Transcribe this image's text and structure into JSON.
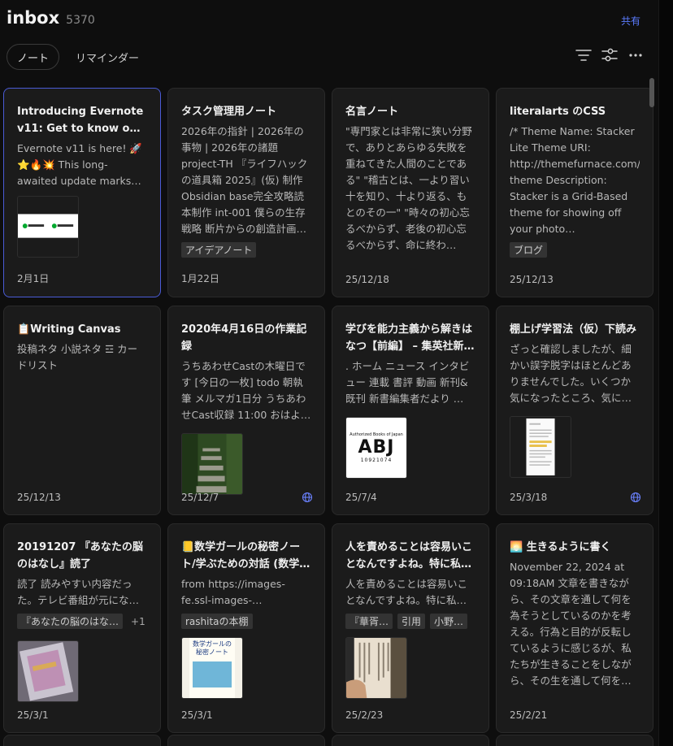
{
  "header": {
    "title": "inbox",
    "count": "5370",
    "share_label": "共有"
  },
  "tabs": [
    {
      "label": "ノート",
      "active": true
    },
    {
      "label": "リマインダー",
      "active": false
    }
  ],
  "toolbar": {
    "sort_icon": "sort-lines-icon",
    "filter_icon": "sliders-icon",
    "more_icon": "more-horizontal-icon"
  },
  "colors": {
    "accent": "#5b7cff",
    "selected_border": "#4a5bd6",
    "card_bg": "#1b1b1b",
    "page_bg": "#0e0e0e"
  },
  "notes": [
    {
      "title": "Introducing Evernote v11: Get to know our smarte…",
      "snippet": "Evernote v11 is here! 🚀⭐🔥💥 This long-awaited update marks t…",
      "tags": [],
      "date": "2月1日",
      "thumb": "evernote-logo"
    },
    {
      "title": "タスク管理用ノート",
      "snippet": "2026年の指針 | 2026年の事物 | 2026年の諸題 project-TH 『ライフハックの道具箱 2025』(仮) 制作 Obsidian base完全攻略読本制作 int-001 僕らの生存戦略 断片からの創造計画…",
      "tags": [
        "アイデアノート"
      ],
      "date": "1月22日"
    },
    {
      "title": "名言ノート",
      "snippet": "\"専門家とは非常に狭い分野で、ありとあらゆる失敗を重ねてきた人間のことである\" \"稽古とは、一より習い十を知り、十より返る、もとのその一\" \"時々の初心忘るべからず、老後の初心忘るべからず、命に終わ…",
      "tags": [],
      "date": "25/12/18"
    },
    {
      "title": "literalarts のCSS",
      "snippet": "/* Theme Name: Stacker Lite Theme URI: http://themefurnace.com/stacker-theme Description: Stacker is a Grid-Based theme for showing off your photo…",
      "tags": [
        "ブログ"
      ],
      "date": "25/12/13"
    },
    {
      "title": "📋Writing Canvas",
      "snippet": "投稿ネタ 小説ネタ ☲ カードリスト",
      "tags": [],
      "date": "25/12/13"
    },
    {
      "title": "2020年4月16日の作業記録",
      "snippet": "うちあわせCastの木曜日です [今日の一枚] todo 朝執筆 メルマガ1日分 うちあわせCast収録 11:00 おはよ…",
      "tags": [],
      "date": "25/12/7",
      "thumb": "stairs-photo",
      "web": true
    },
    {
      "title": "学びを能力主義から解きはなつ【前編】 – 集英社新…",
      "snippet": ". ホーム ニュース インタビュー 連載 書評 動画 新刊&既刊 新書編集者だより …",
      "tags": [],
      "date": "25/7/4",
      "thumb": "abj-logo",
      "thumb_text": {
        "top": "Authorized Books of Japan",
        "main": "ABJ",
        "code": "10921074"
      }
    },
    {
      "title": "棚上げ学習法（仮）下読み",
      "snippet": "ざっと確認しましたが、細かい誤字脱字はほとんどありませんでした。いくつか気になったところ、気になった読み…",
      "tags": [],
      "date": "25/3/18",
      "thumb": "document-page",
      "web": true
    },
    {
      "title": "20191207 『あなたの脳のはなし』読了",
      "snippet": "読了 読みやすい内容だった。テレビ番組が元にな…",
      "tags": [
        "『あなたの脳のはな…"
      ],
      "tags_more": "+1",
      "date": "25/3/1",
      "thumb": "book-photo"
    },
    {
      "title": "📒数学ガールの秘密ノート/学ぶための対話 (数学…",
      "snippet": "from https://images-fe.ssl-images-…",
      "tags": [
        "rashitaの本棚"
      ],
      "date": "25/3/1",
      "thumb": "book-cover",
      "thumb_text": {
        "main": "数学ガールの秘密ノート"
      }
    },
    {
      "title": "人を責めることは容易いことなんですよね。特に私…",
      "snippet": "人を責めることは容易いことなんですよね。特に私…",
      "tags": [
        "『華胥…",
        "引用",
        "小野…"
      ],
      "date": "25/2/23",
      "thumb": "reading-photo"
    },
    {
      "title": "🌅 生きるように書く",
      "snippet": "November 22, 2024 at 09:18AM 文章を書きながら、その文章を通して何を為そうとしているのかを考える。行為と目的が反転しているように感じるが、私たちが生きることをしながら、その生を通して何を…",
      "tags": [],
      "date": "25/2/21"
    }
  ]
}
